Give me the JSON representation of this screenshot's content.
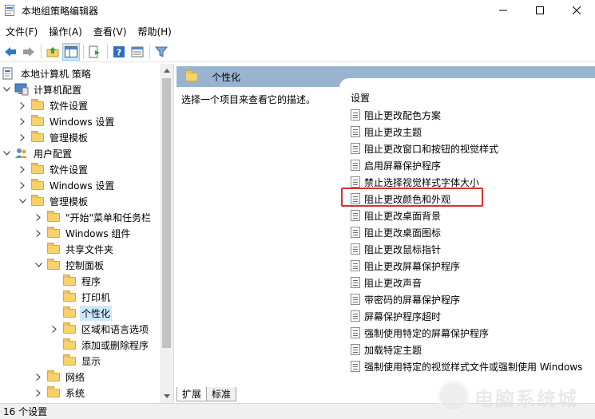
{
  "window": {
    "title": "本地组策略编辑器",
    "controls": {
      "minimize": "—",
      "maximize": "☐",
      "close": "✕"
    }
  },
  "menu": [
    {
      "label": "文件(F)"
    },
    {
      "label": "操作(A)"
    },
    {
      "label": "查看(V)"
    },
    {
      "label": "帮助(H)"
    }
  ],
  "toolbar": {
    "buttons": [
      "back-arrow",
      "forward-arrow",
      "up-folder",
      "show-hide-tree",
      "export-list",
      "help",
      "properties",
      "filter"
    ]
  },
  "tree": {
    "items": [
      {
        "label": "本地计算机 策略",
        "expander": ""
      },
      {
        "label": "计算机配置",
        "expander": "v"
      },
      {
        "label": "软件设置",
        "expander": ">"
      },
      {
        "label": "Windows 设置",
        "expander": ">"
      },
      {
        "label": "管理模板",
        "expander": ">"
      },
      {
        "label": "用户配置",
        "expander": "v"
      },
      {
        "label": "软件设置",
        "expander": ">"
      },
      {
        "label": "Windows 设置",
        "expander": ">"
      },
      {
        "label": "管理模板",
        "expander": "v"
      },
      {
        "label": "\"开始\"菜单和任务栏",
        "expander": ">"
      },
      {
        "label": "Windows 组件",
        "expander": ">"
      },
      {
        "label": "共享文件夹",
        "expander": ""
      },
      {
        "label": "控制面板",
        "expander": "v"
      },
      {
        "label": "程序",
        "expander": ""
      },
      {
        "label": "打印机",
        "expander": ""
      },
      {
        "label": "个性化",
        "expander": ""
      },
      {
        "label": "区域和语言选项",
        "expander": ">"
      },
      {
        "label": "添加或删除程序",
        "expander": ""
      },
      {
        "label": "显示",
        "expander": ""
      },
      {
        "label": "网络",
        "expander": ">"
      },
      {
        "label": "系统",
        "expander": ">"
      }
    ]
  },
  "right": {
    "header": "个性化",
    "description": "选择一个项目来查看它的描述。",
    "settings_title": "设置",
    "settings": [
      "阻止更改配色方案",
      "阻止更改主题",
      "阻止更改窗口和按钮的视觉样式",
      "启用屏幕保护程序",
      "禁止选择视觉样式字体大小",
      "阻止更改颜色和外观",
      "阻止更改桌面背景",
      "阻止更改桌面图标",
      "阻止更改鼠标指针",
      "阻止更改屏幕保护程序",
      "阻止更改声音",
      "带密码的屏幕保护程序",
      "屏幕保护程序超时",
      "强制使用特定的屏幕保护程序",
      "加载特定主题",
      "强制使用特定的视觉样式文件或强制使用 Windows"
    ]
  },
  "tabs": [
    "扩展",
    "标准"
  ],
  "status": "16 个设置",
  "watermark": "电脑系统城",
  "colors": {
    "header_bg": "#99b4d1",
    "selection": "#cce8ff",
    "highlight_box": "#d9302f"
  }
}
